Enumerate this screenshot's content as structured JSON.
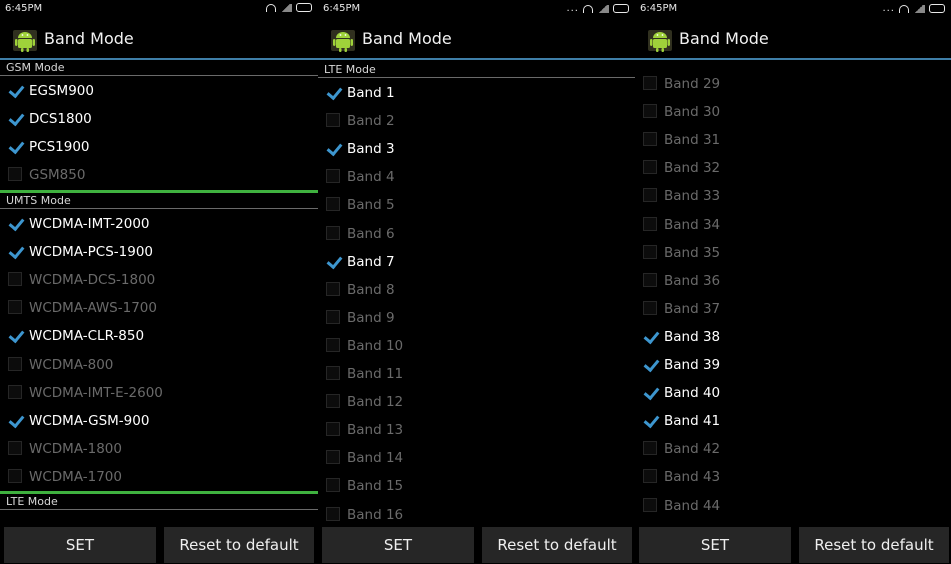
{
  "screens": [
    {
      "status_time": "6:45PM",
      "status_dots": "",
      "title": "Band Mode",
      "sections": [
        {
          "header": "GSM Mode",
          "items": [
            {
              "label": "EGSM900",
              "checked": true
            },
            {
              "label": "DCS1800",
              "checked": true
            },
            {
              "label": "PCS1900",
              "checked": true
            },
            {
              "label": "GSM850",
              "checked": false
            }
          ]
        },
        {
          "header": "UMTS Mode",
          "items": [
            {
              "label": "WCDMA-IMT-2000",
              "checked": true
            },
            {
              "label": "WCDMA-PCS-1900",
              "checked": true
            },
            {
              "label": "WCDMA-DCS-1800",
              "checked": false
            },
            {
              "label": "WCDMA-AWS-1700",
              "checked": false
            },
            {
              "label": "WCDMA-CLR-850",
              "checked": true
            },
            {
              "label": "WCDMA-800",
              "checked": false
            },
            {
              "label": "WCDMA-IMT-E-2600",
              "checked": false
            },
            {
              "label": "WCDMA-GSM-900",
              "checked": true
            },
            {
              "label": "WCDMA-1800",
              "checked": false
            },
            {
              "label": "WCDMA-1700",
              "checked": false
            }
          ]
        },
        {
          "header": "LTE Mode",
          "items": []
        }
      ],
      "set_label": "SET",
      "reset_label": "Reset to default"
    },
    {
      "status_time": "6:45PM",
      "status_dots": "...",
      "title": "Band Mode",
      "sections": [
        {
          "header": "LTE Mode",
          "items": [
            {
              "label": "Band 1",
              "checked": true
            },
            {
              "label": "Band 2",
              "checked": false
            },
            {
              "label": "Band 3",
              "checked": true
            },
            {
              "label": "Band 4",
              "checked": false
            },
            {
              "label": "Band 5",
              "checked": false
            },
            {
              "label": "Band 6",
              "checked": false
            },
            {
              "label": "Band 7",
              "checked": true
            },
            {
              "label": "Band 8",
              "checked": false
            },
            {
              "label": "Band 9",
              "checked": false
            },
            {
              "label": "Band 10",
              "checked": false
            },
            {
              "label": "Band 11",
              "checked": false
            },
            {
              "label": "Band 12",
              "checked": false
            },
            {
              "label": "Band 13",
              "checked": false
            },
            {
              "label": "Band 14",
              "checked": false
            },
            {
              "label": "Band 15",
              "checked": false
            },
            {
              "label": "Band 16",
              "checked": false
            }
          ]
        }
      ],
      "set_label": "SET",
      "reset_label": "Reset to default"
    },
    {
      "status_time": "6:45PM",
      "status_dots": "...",
      "title": "Band Mode",
      "sections": [
        {
          "header": "",
          "items": [
            {
              "label": "Band 29",
              "checked": false
            },
            {
              "label": "Band 30",
              "checked": false
            },
            {
              "label": "Band 31",
              "checked": false
            },
            {
              "label": "Band 32",
              "checked": false
            },
            {
              "label": "Band 33",
              "checked": false
            },
            {
              "label": "Band 34",
              "checked": false
            },
            {
              "label": "Band 35",
              "checked": false
            },
            {
              "label": "Band 36",
              "checked": false
            },
            {
              "label": "Band 37",
              "checked": false
            },
            {
              "label": "Band 38",
              "checked": true
            },
            {
              "label": "Band 39",
              "checked": true
            },
            {
              "label": "Band 40",
              "checked": true
            },
            {
              "label": "Band 41",
              "checked": true
            },
            {
              "label": "Band 42",
              "checked": false
            },
            {
              "label": "Band 43",
              "checked": false
            },
            {
              "label": "Band 44",
              "checked": false
            }
          ]
        }
      ],
      "set_label": "SET",
      "reset_label": "Reset to default"
    }
  ]
}
